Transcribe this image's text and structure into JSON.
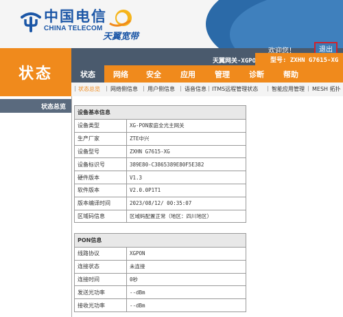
{
  "brand": {
    "logo_cn": "中国电信",
    "logo_en": "CHINA TELECOM",
    "broadband": "天翼宽带",
    "accent_orange": "#f08a1c",
    "accent_blue": "#1b56a6"
  },
  "header": {
    "welcome": "欢迎您！",
    "exit_label": "退出",
    "gateway_name": "天翼网关-XGPON",
    "model_label": "型号: ZXHN G7615-XG"
  },
  "page_title": "状态",
  "tabs": [
    "状态",
    "网络",
    "安全",
    "应用",
    "管理",
    "诊断",
    "帮助"
  ],
  "subnav": [
    "状态总览",
    "网络侧信息",
    "用户侧信息",
    "语音信息",
    "ITMS远程管理状态",
    "智能应用管理",
    "MESH 拓扑"
  ],
  "sidebar": {
    "items": [
      "状态总览"
    ]
  },
  "device_info": {
    "title": "设备基本信息",
    "rows": [
      {
        "label": "设备类型",
        "value": "XG-PON家庭全光主网关"
      },
      {
        "label": "生产厂家",
        "value": "ZTE中兴"
      },
      {
        "label": "设备型号",
        "value": "ZXHN  G7615-XG"
      },
      {
        "label": "设备标识号",
        "value": "389E80-C3865389E80F5E382"
      },
      {
        "label": "硬件版本",
        "value": "V1.3"
      },
      {
        "label": "软件版本",
        "value": "V2.0.0P1T1"
      },
      {
        "label": "版本编译时间",
        "value": "2023/08/12/  00:35:07"
      },
      {
        "label": "区域码信息",
        "value": "区域码配置正常（地区：四川地区）"
      }
    ]
  },
  "pon_info": {
    "title": "PON信息",
    "rows": [
      {
        "label": "线路协议",
        "value": "XGPON"
      },
      {
        "label": "连接状态",
        "value": "未连接"
      },
      {
        "label": "连接时间",
        "value": "0秒"
      },
      {
        "label": "发送光功率",
        "value": "--dBm"
      },
      {
        "label": "接收光功率",
        "value": "--dBm"
      }
    ]
  }
}
